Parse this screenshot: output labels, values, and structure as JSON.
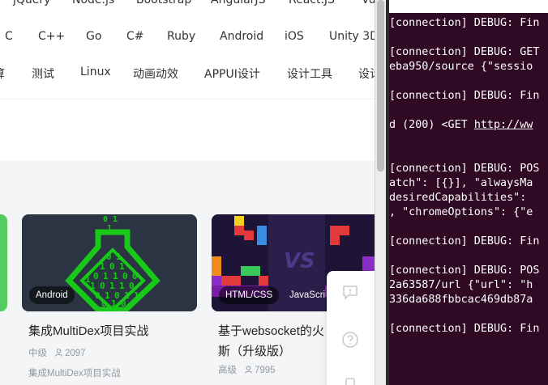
{
  "browser": {
    "nav_row_1": [
      "jQuery",
      "Node.js",
      "Bootstrap",
      "AngularJS",
      "React.JS",
      "Vu"
    ],
    "nav_row_2": [
      "C",
      "C++",
      "Go",
      "C#",
      "Ruby",
      "Android",
      "iOS",
      "Unity 3D"
    ],
    "nav_row_3": [
      "算",
      "测试",
      "Linux",
      "动画动效",
      "APPUI设计",
      "设计工具",
      "设计"
    ],
    "cards": [
      {
        "tag": "Android",
        "title": "集成MultiDex项目实战",
        "level": "中级",
        "learners": "2097",
        "subtitle": "集成MultiDex项目实战",
        "thumb_digits": [
          "0",
          "1",
          "1",
          "0",
          "1",
          "0",
          "1",
          "1",
          "0",
          "0",
          "1",
          "0",
          "1",
          "1",
          "0",
          "0",
          "1",
          "0",
          "1",
          "1",
          "0",
          "1",
          "0",
          "1"
        ]
      },
      {
        "tags": [
          "HTML/CSS",
          "JavaScri"
        ],
        "title_line_1": "基于websocket的火",
        "title_line_2": "斯（升级版）",
        "level": "高级",
        "learners": "7995",
        "thumb_text": "VS"
      }
    ]
  },
  "terminal": {
    "lines": [
      "[connection] DEBUG: Fin",
      "[connection] DEBUG: GET",
      "eba950/source {\"sessio",
      "[connection] DEBUG: Fin",
      "d (200) <GET ",
      "[connection] DEBUG: POS",
      "atch\": [{}], \"alwaysMa",
      "desiredCapabilities\":",
      ", \"chromeOptions\": {\"e",
      "[connection] DEBUG: Fin",
      "[connection] DEBUG: POS",
      "2a63587/url {\"url\": \"h",
      "336da688fbbcac469db87a",
      "[connection] DEBUG: Fin"
    ],
    "link_fragment": "http://ww",
    "colors": {
      "background": "#300a24",
      "text": "#ffffff"
    }
  },
  "colors": {
    "accent_green": "#1fbf1f",
    "page_bg": "#f4f5f7"
  }
}
